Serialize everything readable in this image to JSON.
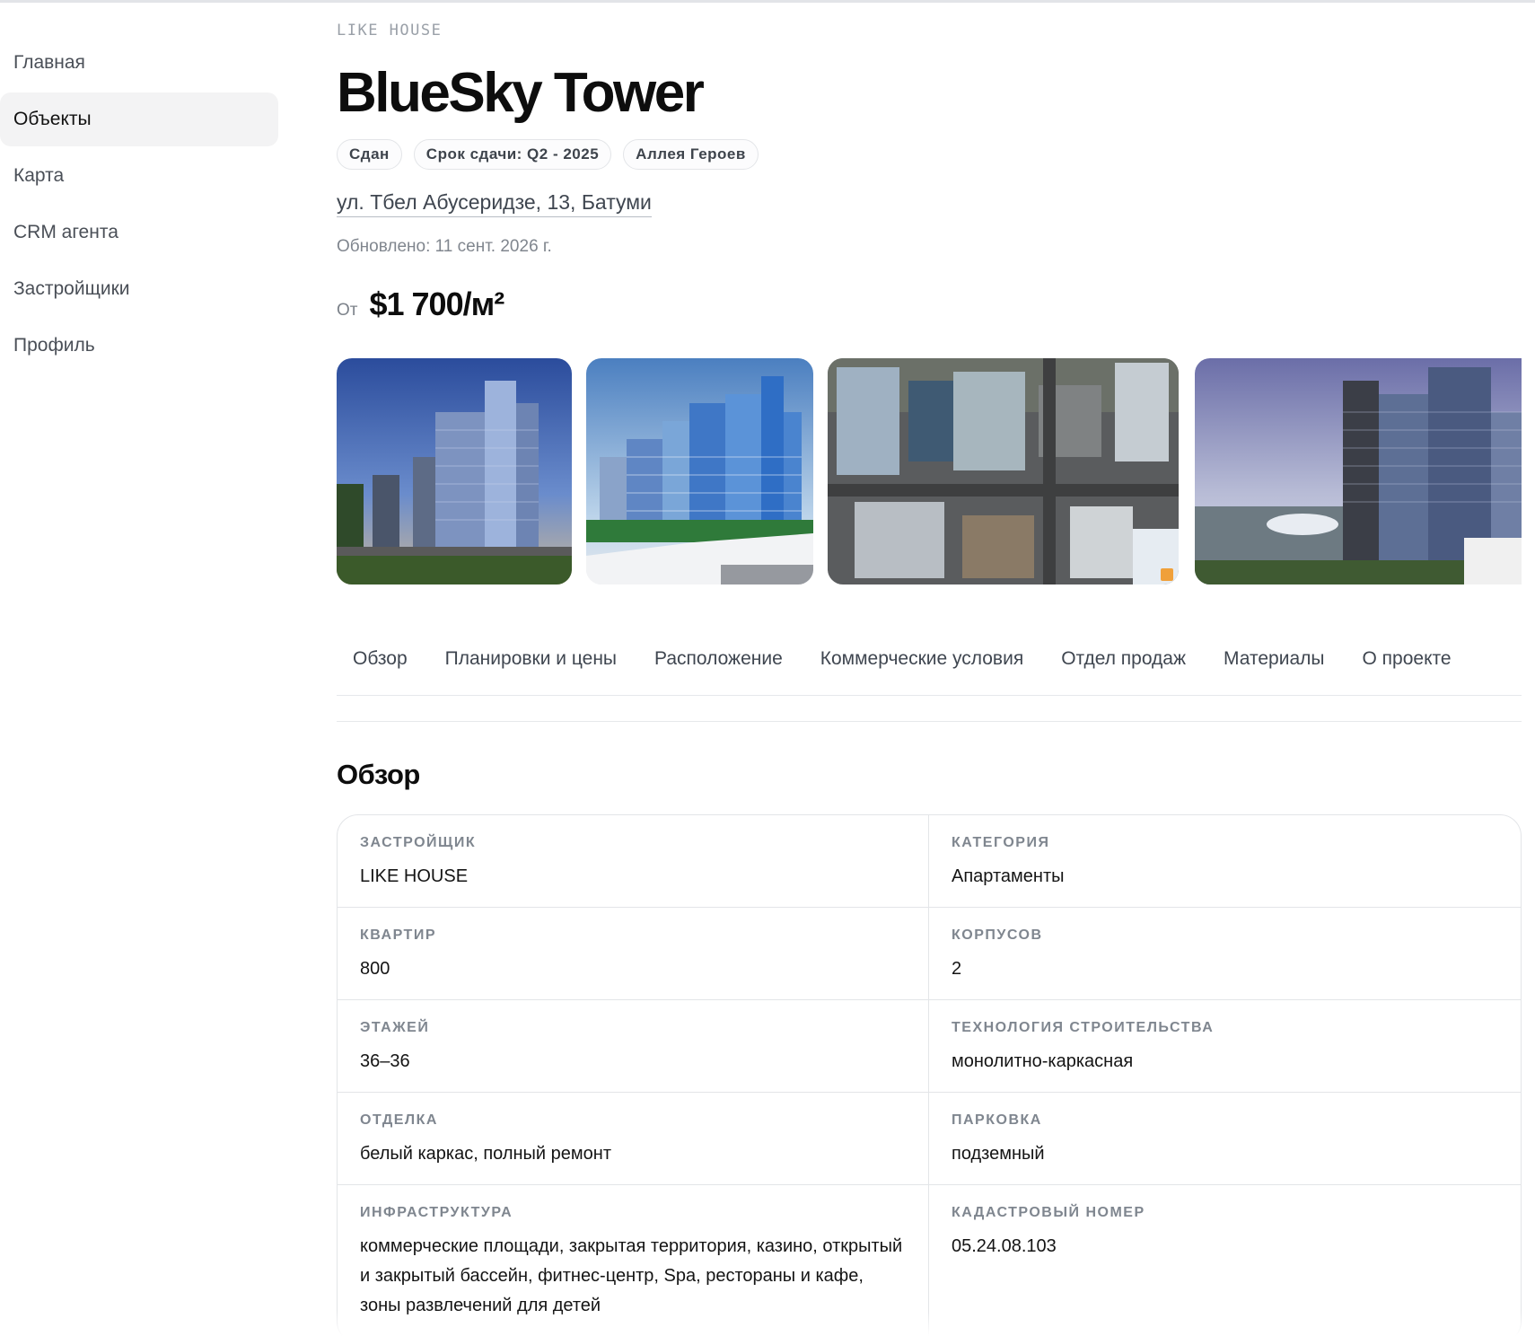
{
  "sidebar": {
    "items": [
      {
        "label": "Главная"
      },
      {
        "label": "Объекты"
      },
      {
        "label": "Карта"
      },
      {
        "label": "CRM агента"
      },
      {
        "label": "Застройщики"
      },
      {
        "label": "Профиль"
      }
    ]
  },
  "project": {
    "developer_eyebrow": "LIKE HOUSE",
    "title": "BlueSky Tower",
    "tags": [
      "Сдан",
      "Срок сдачи: Q2 - 2025",
      "Аллея Героев"
    ],
    "address": "ул. Тбел Абусеридзе, 13, Батуми",
    "updated": "Обновлено: 11 сент. 2026 г.",
    "price_prefix": "От",
    "price_value": "$1 700/м²"
  },
  "gallery": {
    "photos": [
      "tower-render-1",
      "tower-render-2",
      "aerial-view",
      "tower-render-3"
    ]
  },
  "tabs": [
    "Обзор",
    "Планировки и цены",
    "Расположение",
    "Коммерческие условия",
    "Отдел продаж",
    "Материалы",
    "О проекте"
  ],
  "overview": {
    "heading": "Обзор",
    "fields": [
      {
        "label": "ЗАСТРОЙЩИК",
        "value": "LIKE HOUSE"
      },
      {
        "label": "КАТЕГОРИЯ",
        "value": "Апартаменты"
      },
      {
        "label": "КВАРТИР",
        "value": "800"
      },
      {
        "label": "КОРПУСОВ",
        "value": "2"
      },
      {
        "label": "ЭТАЖЕЙ",
        "value": "36–36"
      },
      {
        "label": "ТЕХНОЛОГИЯ СТРОИТЕЛЬСТВА",
        "value": "монолитно-каркасная"
      },
      {
        "label": "ОТДЕЛКА",
        "value": "белый каркас, полный ремонт"
      },
      {
        "label": "ПАРКОВКА",
        "value": "подземный"
      },
      {
        "label": "ИНФРАСТРУКТУРА",
        "value": "коммерческие площади, закрытая территория, казино, открытый и закрытый бассейн, фитнес-центр, Spa, рестораны и кафе, зоны развлечений для детей"
      },
      {
        "label": "КАДАСТРОВЫЙ НОМЕР",
        "value": "05.24.08.103"
      }
    ]
  },
  "colors": {
    "accent_active_bg": "#f3f3f4",
    "text_primary": "#0d0d0d",
    "text_muted": "#80868e",
    "border": "#e3e5e8"
  }
}
